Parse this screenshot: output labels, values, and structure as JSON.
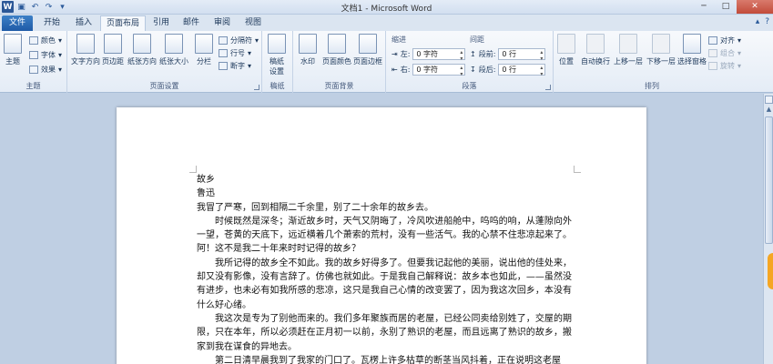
{
  "window": {
    "title": "文档1 - Microsoft Word"
  },
  "tabs": [
    "文件",
    "开始",
    "插入",
    "页面布局",
    "引用",
    "邮件",
    "审阅",
    "视图"
  ],
  "ribbon": {
    "theme": {
      "label": "主题",
      "btn": "主题",
      "colors": "颜色",
      "fonts": "字体",
      "effects": "效果"
    },
    "page_setup": {
      "label": "页面设置",
      "text_direction": "文字方向",
      "margins": "页边距",
      "orientation": "纸张方向",
      "size": "纸张大小",
      "columns": "分栏",
      "breaks": "分隔符",
      "line_numbers": "行号",
      "hyphenation": "断字"
    },
    "draft": {
      "label": "稿纸",
      "btn1": "稿纸",
      "btn2": "设置"
    },
    "page_background": {
      "label": "页面背景",
      "watermark": "水印",
      "page_color": "页面颜色",
      "page_borders": "页面边框"
    },
    "paragraph": {
      "label": "段落",
      "indent_title": "缩进",
      "spacing_title": "间距",
      "left_label": "左:",
      "left_value": "0 字符",
      "right_label": "右:",
      "right_value": "0 字符",
      "before_label": "段前:",
      "before_value": "0 行",
      "after_label": "段后:",
      "after_value": "0 行"
    },
    "arrange": {
      "label": "排列",
      "position": "位置",
      "wrap": "自动换行",
      "forward": "上移一层",
      "backward": "下移一层",
      "selection_pane": "选择窗格",
      "align": "对齐",
      "group": "组合",
      "rotate": "旋转"
    }
  },
  "document": {
    "paragraphs": [
      {
        "text": "故乡",
        "indent": false
      },
      {
        "text": "鲁迅",
        "indent": false
      },
      {
        "text": "我冒了严寒，回到相隔二千余里，别了二十余年的故乡去。",
        "indent": false
      },
      {
        "text": "时候既然是深冬；渐近故乡时，天气又阴晦了，冷风吹进船舱中，呜呜的响，从蓬隙向外一望，苍黄的天底下，远近横着几个萧索的荒村，没有一些活气。我的心禁不住悲凉起来了。阿！这不是我二十年来时时记得的故乡？",
        "indent": true
      },
      {
        "text": "我所记得的故乡全不如此。我的故乡好得多了。但要我记起他的美丽，说出他的佳处来，却又没有影像，没有言辞了。仿佛也就如此。于是我自己解释说：故乡本也如此，——虽然没有进步，也未必有如我所感的悲凉，这只是我自己心情的改变罢了，因为我这次回乡，本没有什么好心绪。",
        "indent": true
      },
      {
        "text": "我这次是专为了别他而来的。我们多年聚族而居的老屋，已经公同卖给别姓了，交屋的期限，只在本年，所以必须赶在正月初一以前，永别了熟识的老屋，而且远离了熟识的故乡，搬家到我在谋食的异地去。",
        "indent": true
      },
      {
        "text": "第二日清早晨我到了我家的门口了。瓦楞上许多枯草的断茎当风抖着，正在说明这老屋",
        "indent": true
      }
    ]
  }
}
